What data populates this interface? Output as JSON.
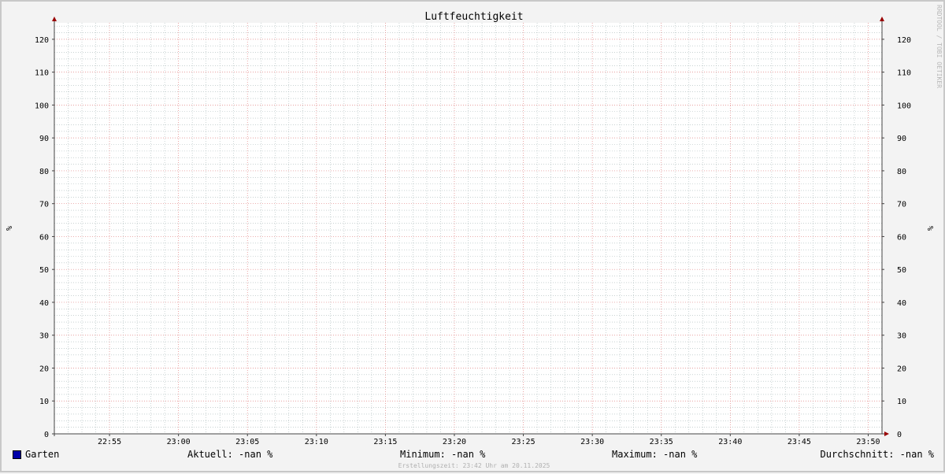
{
  "chart_data": {
    "type": "line",
    "title": "Luftfeuchtigkeit",
    "ylabel": "%",
    "ylabel_right": "%",
    "ylim": [
      0,
      125
    ],
    "y_ticks": [
      0,
      10,
      20,
      30,
      40,
      50,
      60,
      70,
      80,
      90,
      100,
      110,
      120
    ],
    "x_ticks": [
      "22:55",
      "23:00",
      "23:05",
      "23:10",
      "23:15",
      "23:20",
      "23:25",
      "23:30",
      "23:35",
      "23:40",
      "23:45",
      "23:50"
    ],
    "xlim": [
      "22:51",
      "23:51"
    ],
    "grid": true,
    "series": [
      {
        "name": "Garten",
        "color": "#0000a8",
        "values": []
      }
    ]
  },
  "legend": {
    "series_name": "Garten",
    "current": "Aktuell: -nan %",
    "minimum": "Minimum: -nan %",
    "maximum": "Maximum: -nan %",
    "average": "Durchschnitt: -nan %"
  },
  "footer": "Erstellungszeit: 23:42 Uhr am 20.11.2025",
  "watermark": "RRDTOOL / TOBI OETIKER",
  "colors": {
    "major_grid": "#e08080",
    "minor_grid": "#a8b8b8",
    "axis": "#444444",
    "arrow": "#990000"
  }
}
